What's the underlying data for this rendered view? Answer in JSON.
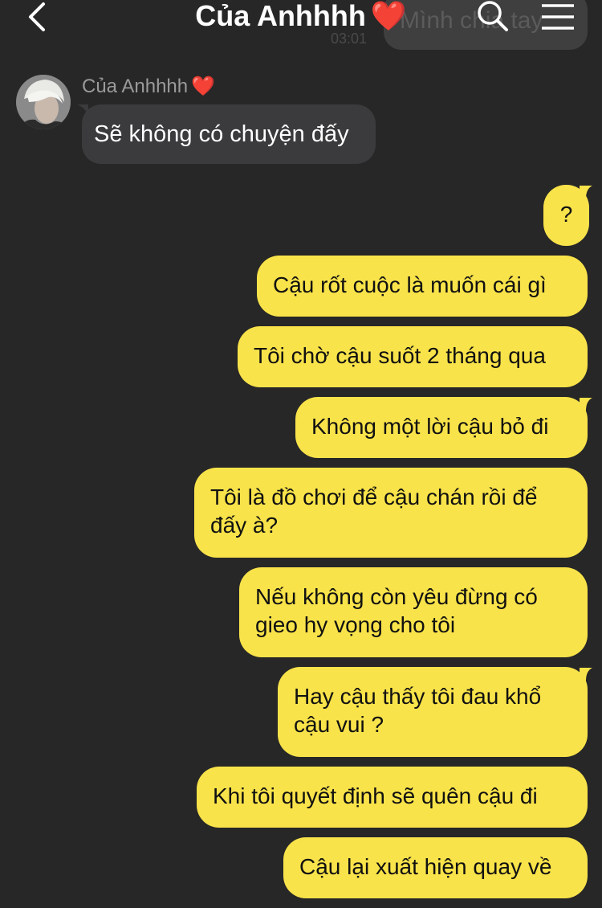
{
  "header": {
    "title": "Của Anhhhh",
    "heart": "❤️",
    "back_icon": "chevron-left-icon",
    "search_icon": "search-icon",
    "menu_icon": "hamburger-menu-icon"
  },
  "ghost": {
    "text": "Mình chia tay",
    "time": "03:01"
  },
  "incoming": {
    "sender_name": "Của Anhhhh",
    "heart": "❤️",
    "message": "Sẽ không có chuyện đấy"
  },
  "outgoing": [
    "?",
    "Cậu rốt cuộc là muốn cái gì",
    "Tôi chờ cậu suốt 2 tháng qua",
    "Không một lời cậu bỏ đi",
    "Tôi là đồ chơi để cậu chán rồi để đấy à?",
    "Nếu không còn yêu đừng có gieo hy vọng cho tôi",
    "Hay cậu thấy tôi đau khổ cậu vui ?",
    "Khi tôi quyết định sẽ quên cậu đi",
    "Cậu lại xuất hiện quay về"
  ],
  "colors": {
    "background": "#272727",
    "outgoing_bubble": "#f9e34a",
    "incoming_bubble": "#3b3b3d",
    "heart": "#ff2d3a"
  }
}
